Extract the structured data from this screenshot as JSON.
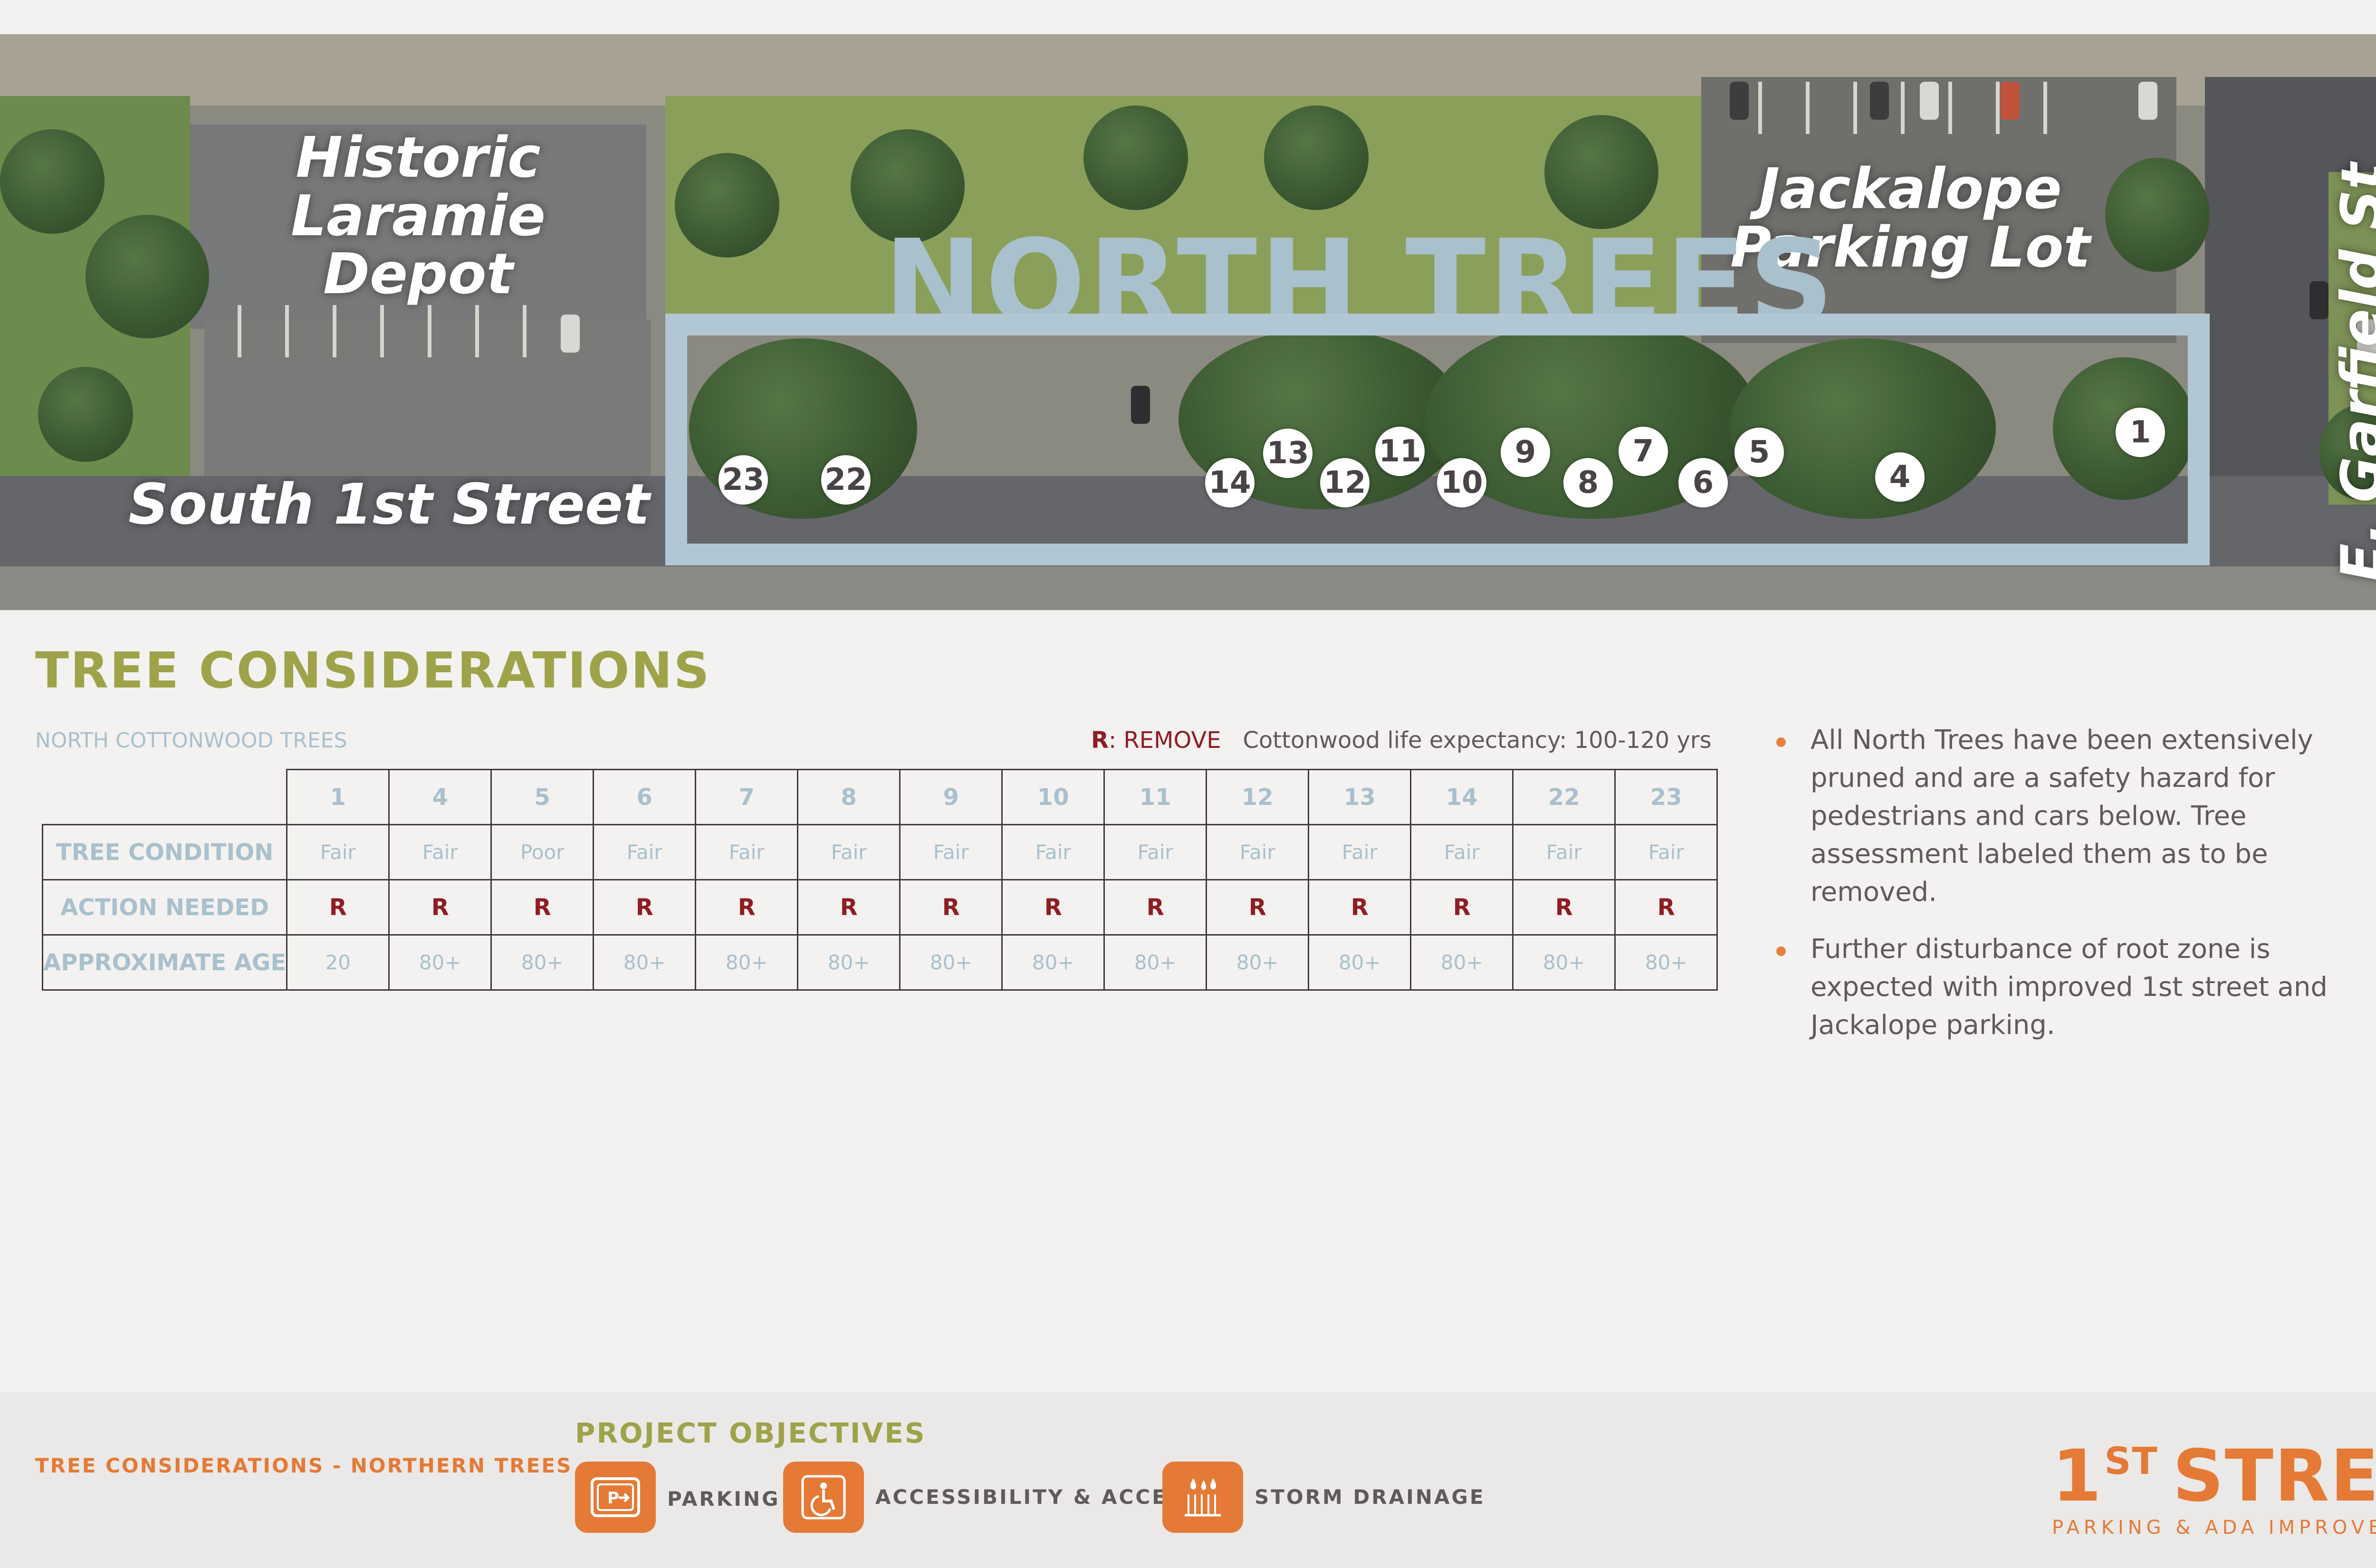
{
  "map": {
    "title": "NORTH TREES",
    "labels": {
      "depot_line1": "Historic",
      "depot_line2": "Laramie",
      "depot_line3": "Depot",
      "jackalope_line1": "Jackalope",
      "jackalope_line2": "Parking Lot",
      "street_south": "South 1st Street",
      "street_garfield": "E. Garfield St"
    },
    "markers": [
      "23",
      "22",
      "14",
      "13",
      "12",
      "11",
      "10",
      "9",
      "8",
      "7",
      "6",
      "5",
      "4",
      "1"
    ]
  },
  "considerations": {
    "title": "TREE CONSIDERATIONS",
    "subtitle": "NORTH COTTONWOOD TREES",
    "legend_code": "R",
    "legend_text": ": REMOVE",
    "life_expectancy": "Cottonwood life expectancy: 100-120 yrs",
    "table": {
      "columns": [
        "1",
        "4",
        "5",
        "6",
        "7",
        "8",
        "9",
        "10",
        "11",
        "12",
        "13",
        "14",
        "22",
        "23"
      ],
      "rows": [
        {
          "label": "TREE CONDITION",
          "values": [
            "Fair",
            "Fair",
            "Poor",
            "Fair",
            "Fair",
            "Fair",
            "Fair",
            "Fair",
            "Fair",
            "Fair",
            "Fair",
            "Fair",
            "Fair",
            "Fair"
          ]
        },
        {
          "label": "ACTION NEEDED",
          "values": [
            "R",
            "R",
            "R",
            "R",
            "R",
            "R",
            "R",
            "R",
            "R",
            "R",
            "R",
            "R",
            "R",
            "R"
          ]
        },
        {
          "label": "APPROXIMATE AGE",
          "values": [
            "20",
            "80+",
            "80+",
            "80+",
            "80+",
            "80+",
            "80+",
            "80+",
            "80+",
            "80+",
            "80+",
            "80+",
            "80+",
            "80+"
          ]
        }
      ]
    },
    "bullets": [
      "All North Trees have been extensively pruned and are a safety hazard for pedestrians and cars below. Tree assessment labeled them as to be removed.",
      "Further disturbance of root zone is expected with improved 1st street and Jackalope parking."
    ]
  },
  "footer": {
    "page_label": "TREE CONSIDERATIONS - NORTHERN TREES",
    "objectives_title": "PROJECT OBJECTIVES",
    "objectives": [
      {
        "icon": "parking-icon",
        "label": "PARKING"
      },
      {
        "icon": "accessibility-icon",
        "label": "ACCESSIBILITY & ACCESS"
      },
      {
        "icon": "storm-drainage-icon",
        "label": "STORM DRAINAGE"
      }
    ],
    "logo_main": "1",
    "logo_sup": "ST",
    "logo_word": "STREET",
    "logo_sub": "PARKING & ADA IMPROVEMENTS"
  },
  "colors": {
    "accent_orange": "#e47a36",
    "accent_olive": "#9ea34a",
    "light_blue": "#a9c0cd",
    "remove_red": "#8f1d23",
    "body_text": "#5f5a5b"
  }
}
